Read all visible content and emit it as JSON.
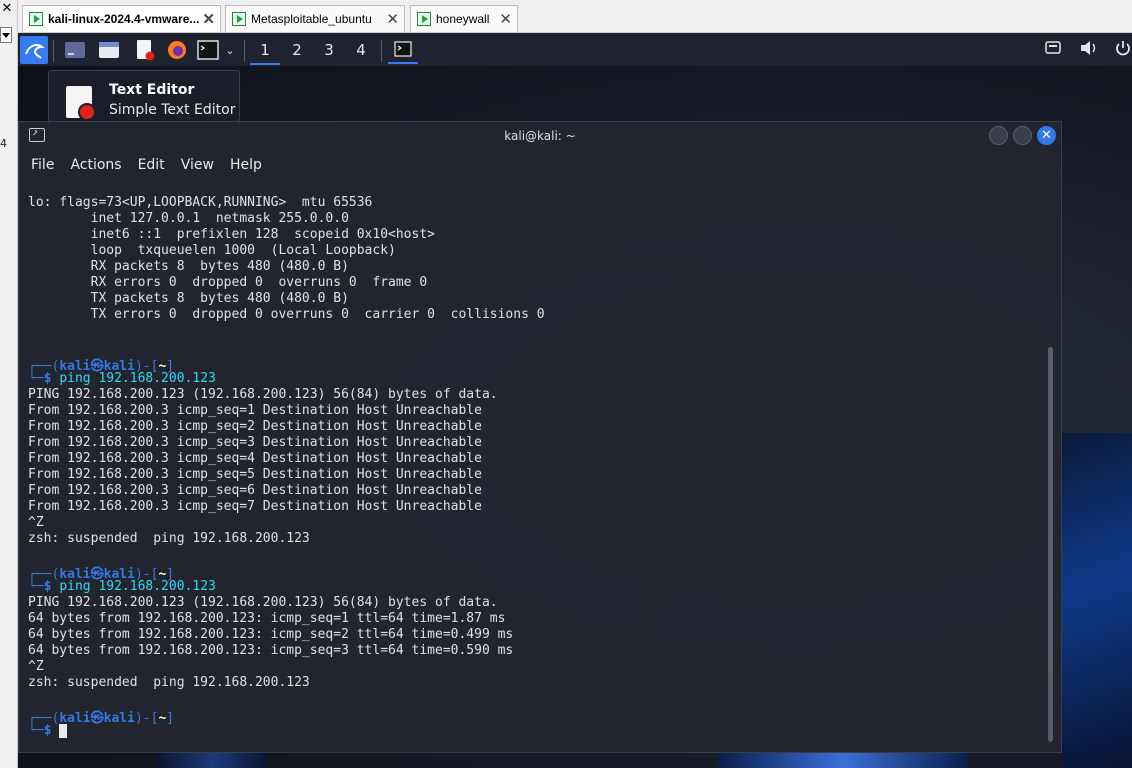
{
  "host": {
    "close_glyph": "✕",
    "side_number": "4"
  },
  "vm_tabs": [
    {
      "label": "kali-linux-2024.4-vmware...",
      "active": true
    },
    {
      "label": "Metasploitable_ubuntu",
      "active": false
    },
    {
      "label": "honeywall",
      "active": false
    }
  ],
  "taskbar": {
    "workspaces": [
      "1",
      "2",
      "3",
      "4"
    ],
    "active_workspace": "1"
  },
  "tooltip": {
    "title": "Text Editor",
    "subtitle": "Simple Text Editor"
  },
  "terminal": {
    "title": "kali@kali: ~",
    "menu": [
      "File",
      "Actions",
      "Edit",
      "View",
      "Help"
    ],
    "prompt_user": "kali",
    "prompt_host": "kali",
    "prompt_dir": "~",
    "commands": [
      "ping 192.168.200.123",
      "ping 192.168.200.123"
    ],
    "output_1": [
      "lo: flags=73<UP,LOOPBACK,RUNNING>  mtu 65536",
      "        inet 127.0.0.1  netmask 255.0.0.0",
      "        inet6 ::1  prefixlen 128  scopeid 0x10<host>",
      "        loop  txqueuelen 1000  (Local Loopback)",
      "        RX packets 8  bytes 480 (480.0 B)",
      "        RX errors 0  dropped 0  overruns 0  frame 0",
      "        TX packets 8  bytes 480 (480.0 B)",
      "        TX errors 0  dropped 0 overruns 0  carrier 0  collisions 0"
    ],
    "output_2": [
      "PING 192.168.200.123 (192.168.200.123) 56(84) bytes of data.",
      "From 192.168.200.3 icmp_seq=1 Destination Host Unreachable",
      "From 192.168.200.3 icmp_seq=2 Destination Host Unreachable",
      "From 192.168.200.3 icmp_seq=3 Destination Host Unreachable",
      "From 192.168.200.3 icmp_seq=4 Destination Host Unreachable",
      "From 192.168.200.3 icmp_seq=5 Destination Host Unreachable",
      "From 192.168.200.3 icmp_seq=6 Destination Host Unreachable",
      "From 192.168.200.3 icmp_seq=7 Destination Host Unreachable",
      "^Z",
      "zsh: suspended  ping 192.168.200.123"
    ],
    "output_3": [
      "PING 192.168.200.123 (192.168.200.123) 56(84) bytes of data.",
      "64 bytes from 192.168.200.123: icmp_seq=1 ttl=64 time=1.87 ms",
      "64 bytes from 192.168.200.123: icmp_seq=2 ttl=64 time=0.499 ms",
      "64 bytes from 192.168.200.123: icmp_seq=3 ttl=64 time=0.590 ms",
      "^Z",
      "zsh: suspended  ping 192.168.200.123"
    ]
  },
  "colors": {
    "accent": "#367bf0",
    "terminal_bg": "#23262f",
    "command": "#2ee0ff"
  }
}
